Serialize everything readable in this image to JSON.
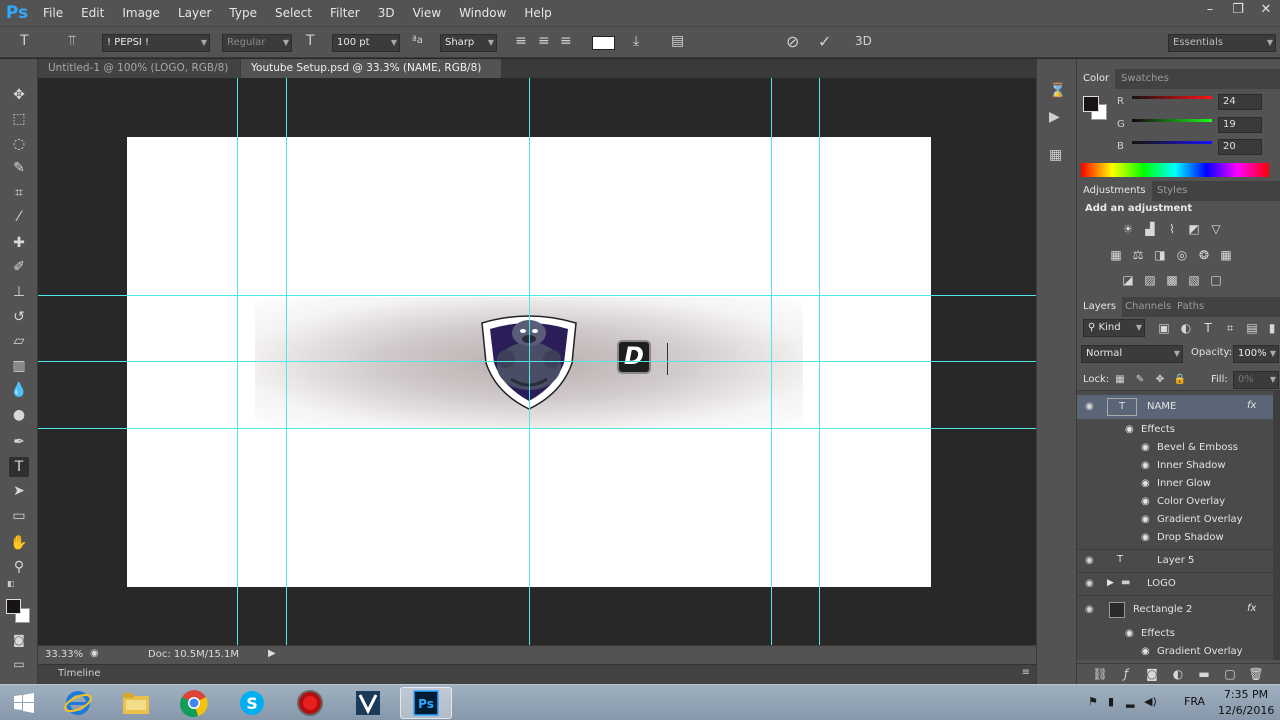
{
  "app": {
    "logo": "Ps",
    "accent": "#31a8ff"
  },
  "menu": [
    "File",
    "Edit",
    "Image",
    "Layer",
    "Type",
    "Select",
    "Filter",
    "3D",
    "View",
    "Window",
    "Help"
  ],
  "window_controls": {
    "minimize": "–",
    "restore": "❐",
    "close": "✕"
  },
  "options": {
    "font_family": "! PEPSI !",
    "font_style": "Regular",
    "font_size": "100 pt",
    "antialias_icon": "ªa",
    "antialias": "Sharp",
    "text_color": "#ffffff",
    "workspace": "Essentials",
    "three_d": "3D"
  },
  "tabs": [
    {
      "label": "Untitled-1 @ 100% (LOGO, RGB/8) *",
      "close": "×"
    },
    {
      "label": "Youtube Setup.psd @ 33.3% (NAME, RGB/8) *",
      "close": "×"
    }
  ],
  "canvas": {
    "text_glyph": "D"
  },
  "status": {
    "zoom": "33.33%",
    "doc": "Doc: 10.5M/15.1M"
  },
  "timeline": {
    "label": "Timeline"
  },
  "color_panel": {
    "tabs": [
      "Color",
      "Swatches"
    ],
    "channels": [
      {
        "label": "R",
        "value": "24"
      },
      {
        "label": "G",
        "value": "19"
      },
      {
        "label": "B",
        "value": "20"
      }
    ]
  },
  "adjustments_panel": {
    "tabs": [
      "Adjustments",
      "Styles"
    ],
    "heading": "Add an adjustment"
  },
  "layers_panel": {
    "tabs": [
      "Layers",
      "Channels",
      "Paths"
    ],
    "kind": "Kind",
    "blend_mode": "Normal",
    "opacity_label": "Opacity:",
    "opacity": "100%",
    "lock_label": "Lock:",
    "fill_label": "Fill:",
    "fill": "0%",
    "layers": [
      {
        "name": "NAME",
        "fx": "fx",
        "effects_label": "Effects",
        "effects": [
          "Bevel & Emboss",
          "Inner Shadow",
          "Inner Glow",
          "Color Overlay",
          "Gradient Overlay",
          "Drop Shadow"
        ]
      },
      {
        "name": "Layer 5"
      },
      {
        "name": "LOGO"
      },
      {
        "name": "Rectangle 2",
        "fx": "fx",
        "effects_label": "Effects",
        "effects": [
          "Gradient Overlay"
        ]
      }
    ]
  },
  "taskbar": {
    "language": "FRA",
    "time": "7:35 PM",
    "date": "12/6/2016"
  }
}
